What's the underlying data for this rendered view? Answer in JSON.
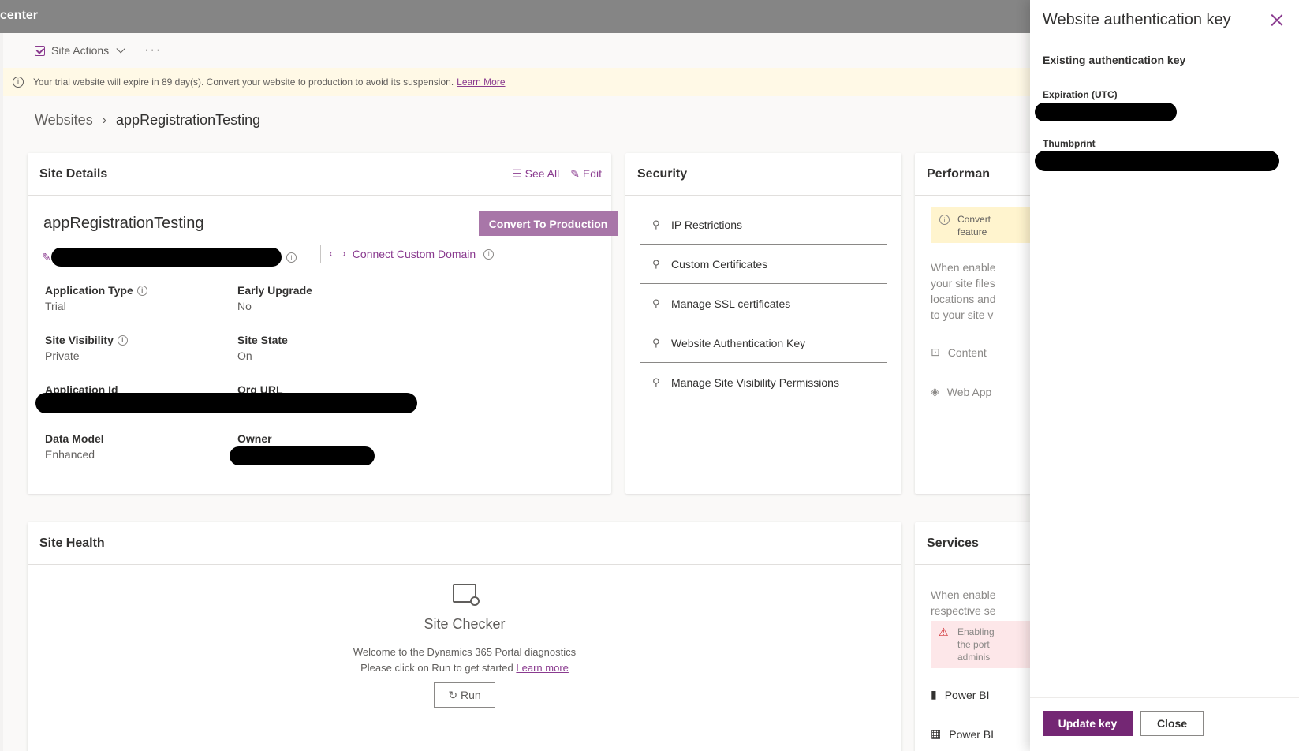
{
  "app": {
    "title": "center"
  },
  "commandbar": {
    "site_actions": "Site Actions",
    "more": "···"
  },
  "banner": {
    "message": "Your trial website will expire in 89 day(s). Convert your website to production to avoid its suspension.",
    "link": "Learn More"
  },
  "breadcrumb": {
    "root": "Websites",
    "current": "appRegistrationTesting"
  },
  "site_details": {
    "title": "Site Details",
    "see_all": "See All",
    "edit": "Edit",
    "site_name": "appRegistrationTesting",
    "convert_button": "Convert To Production",
    "connect_domain": "Connect Custom Domain",
    "fields": {
      "application_type": {
        "label": "Application Type",
        "value": "Trial"
      },
      "early_upgrade": {
        "label": "Early Upgrade",
        "value": "No"
      },
      "site_visibility": {
        "label": "Site Visibility",
        "value": "Private"
      },
      "site_state": {
        "label": "Site State",
        "value": "On"
      },
      "application_id": {
        "label": "Application Id"
      },
      "org_url": {
        "label": "Org URL"
      },
      "data_model": {
        "label": "Data Model",
        "value": "Enhanced"
      },
      "owner": {
        "label": "Owner"
      }
    }
  },
  "security": {
    "title": "Security",
    "items": [
      "IP Restrictions",
      "Custom Certificates",
      "Manage SSL certificates",
      "Website Authentication Key",
      "Manage Site Visibility Permissions"
    ]
  },
  "performance": {
    "title": "Performan",
    "warning": [
      "Convert",
      "feature"
    ],
    "text": [
      "When enable",
      "your site files",
      "locations and",
      "to your site v"
    ],
    "content": "Content",
    "web_app": "Web App"
  },
  "site_health": {
    "title": "Site Health",
    "checker_title": "Site Checker",
    "line1": "Welcome to the Dynamics 365 Portal diagnostics",
    "line2": "Please click on Run to get started",
    "learn_more": "Learn more",
    "run": "Run"
  },
  "services": {
    "title": "Services",
    "text": [
      "When enable",
      "respective se"
    ],
    "warning": [
      "Enabling",
      "the port",
      "adminis"
    ],
    "power_bi_1": "Power BI",
    "power_bi_2": "Power BI"
  },
  "panel": {
    "title": "Website authentication key",
    "subtitle": "Existing authentication key",
    "expiration_label": "Expiration (UTC)",
    "thumbprint_label": "Thumbprint",
    "update_button": "Update key",
    "close_button": "Close"
  },
  "colors": {
    "accent": "#742774",
    "link": "#8a3b8f",
    "banner": "#fff9e6",
    "topbar": "#858585"
  }
}
